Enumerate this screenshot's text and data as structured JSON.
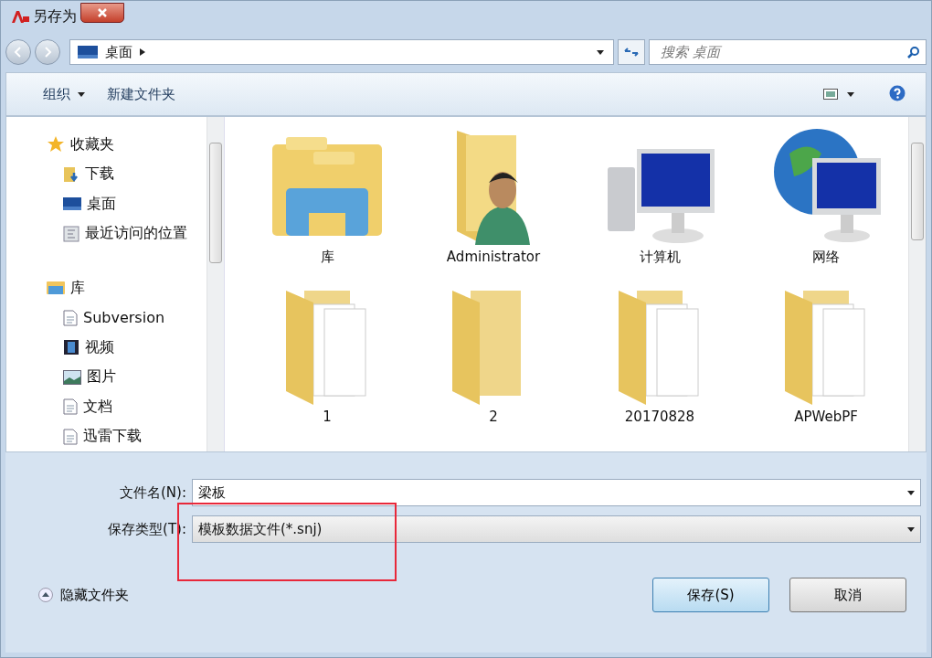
{
  "window": {
    "title": "另存为"
  },
  "address": {
    "crumbs": [
      "桌面"
    ],
    "search_placeholder": "搜索 桌面"
  },
  "toolbar": {
    "items": [
      "组织",
      "新建文件夹"
    ]
  },
  "sidebar": {
    "groups": [
      {
        "label": "收藏夹",
        "kind": "star",
        "children": [
          {
            "label": "下载",
            "kind": "download"
          },
          {
            "label": "桌面",
            "kind": "desktop"
          },
          {
            "label": "最近访问的位置",
            "kind": "recent"
          }
        ]
      },
      {
        "label": "库",
        "kind": "library",
        "children": [
          {
            "label": "Subversion",
            "kind": "doc"
          },
          {
            "label": "视频",
            "kind": "video"
          },
          {
            "label": "图片",
            "kind": "picture"
          },
          {
            "label": "文档",
            "kind": "doc"
          },
          {
            "label": "迅雷下载",
            "kind": "doc"
          }
        ]
      }
    ]
  },
  "items": [
    {
      "label": "库",
      "kind": "library"
    },
    {
      "label": "Administrator",
      "kind": "user"
    },
    {
      "label": "计算机",
      "kind": "computer"
    },
    {
      "label": "网络",
      "kind": "network"
    },
    {
      "label": "1",
      "kind": "folder"
    },
    {
      "label": "2",
      "kind": "folder-empty"
    },
    {
      "label": "20170828",
      "kind": "folder"
    },
    {
      "label": "APWebPF",
      "kind": "folder"
    }
  ],
  "form": {
    "filename_label": "文件名(N):",
    "filename": "梁板",
    "type_label": "保存类型(T):",
    "type": "模板数据文件(*.snj)"
  },
  "hide_folders": "隐藏文件夹",
  "buttons": [
    "保存(S)",
    "取消"
  ]
}
